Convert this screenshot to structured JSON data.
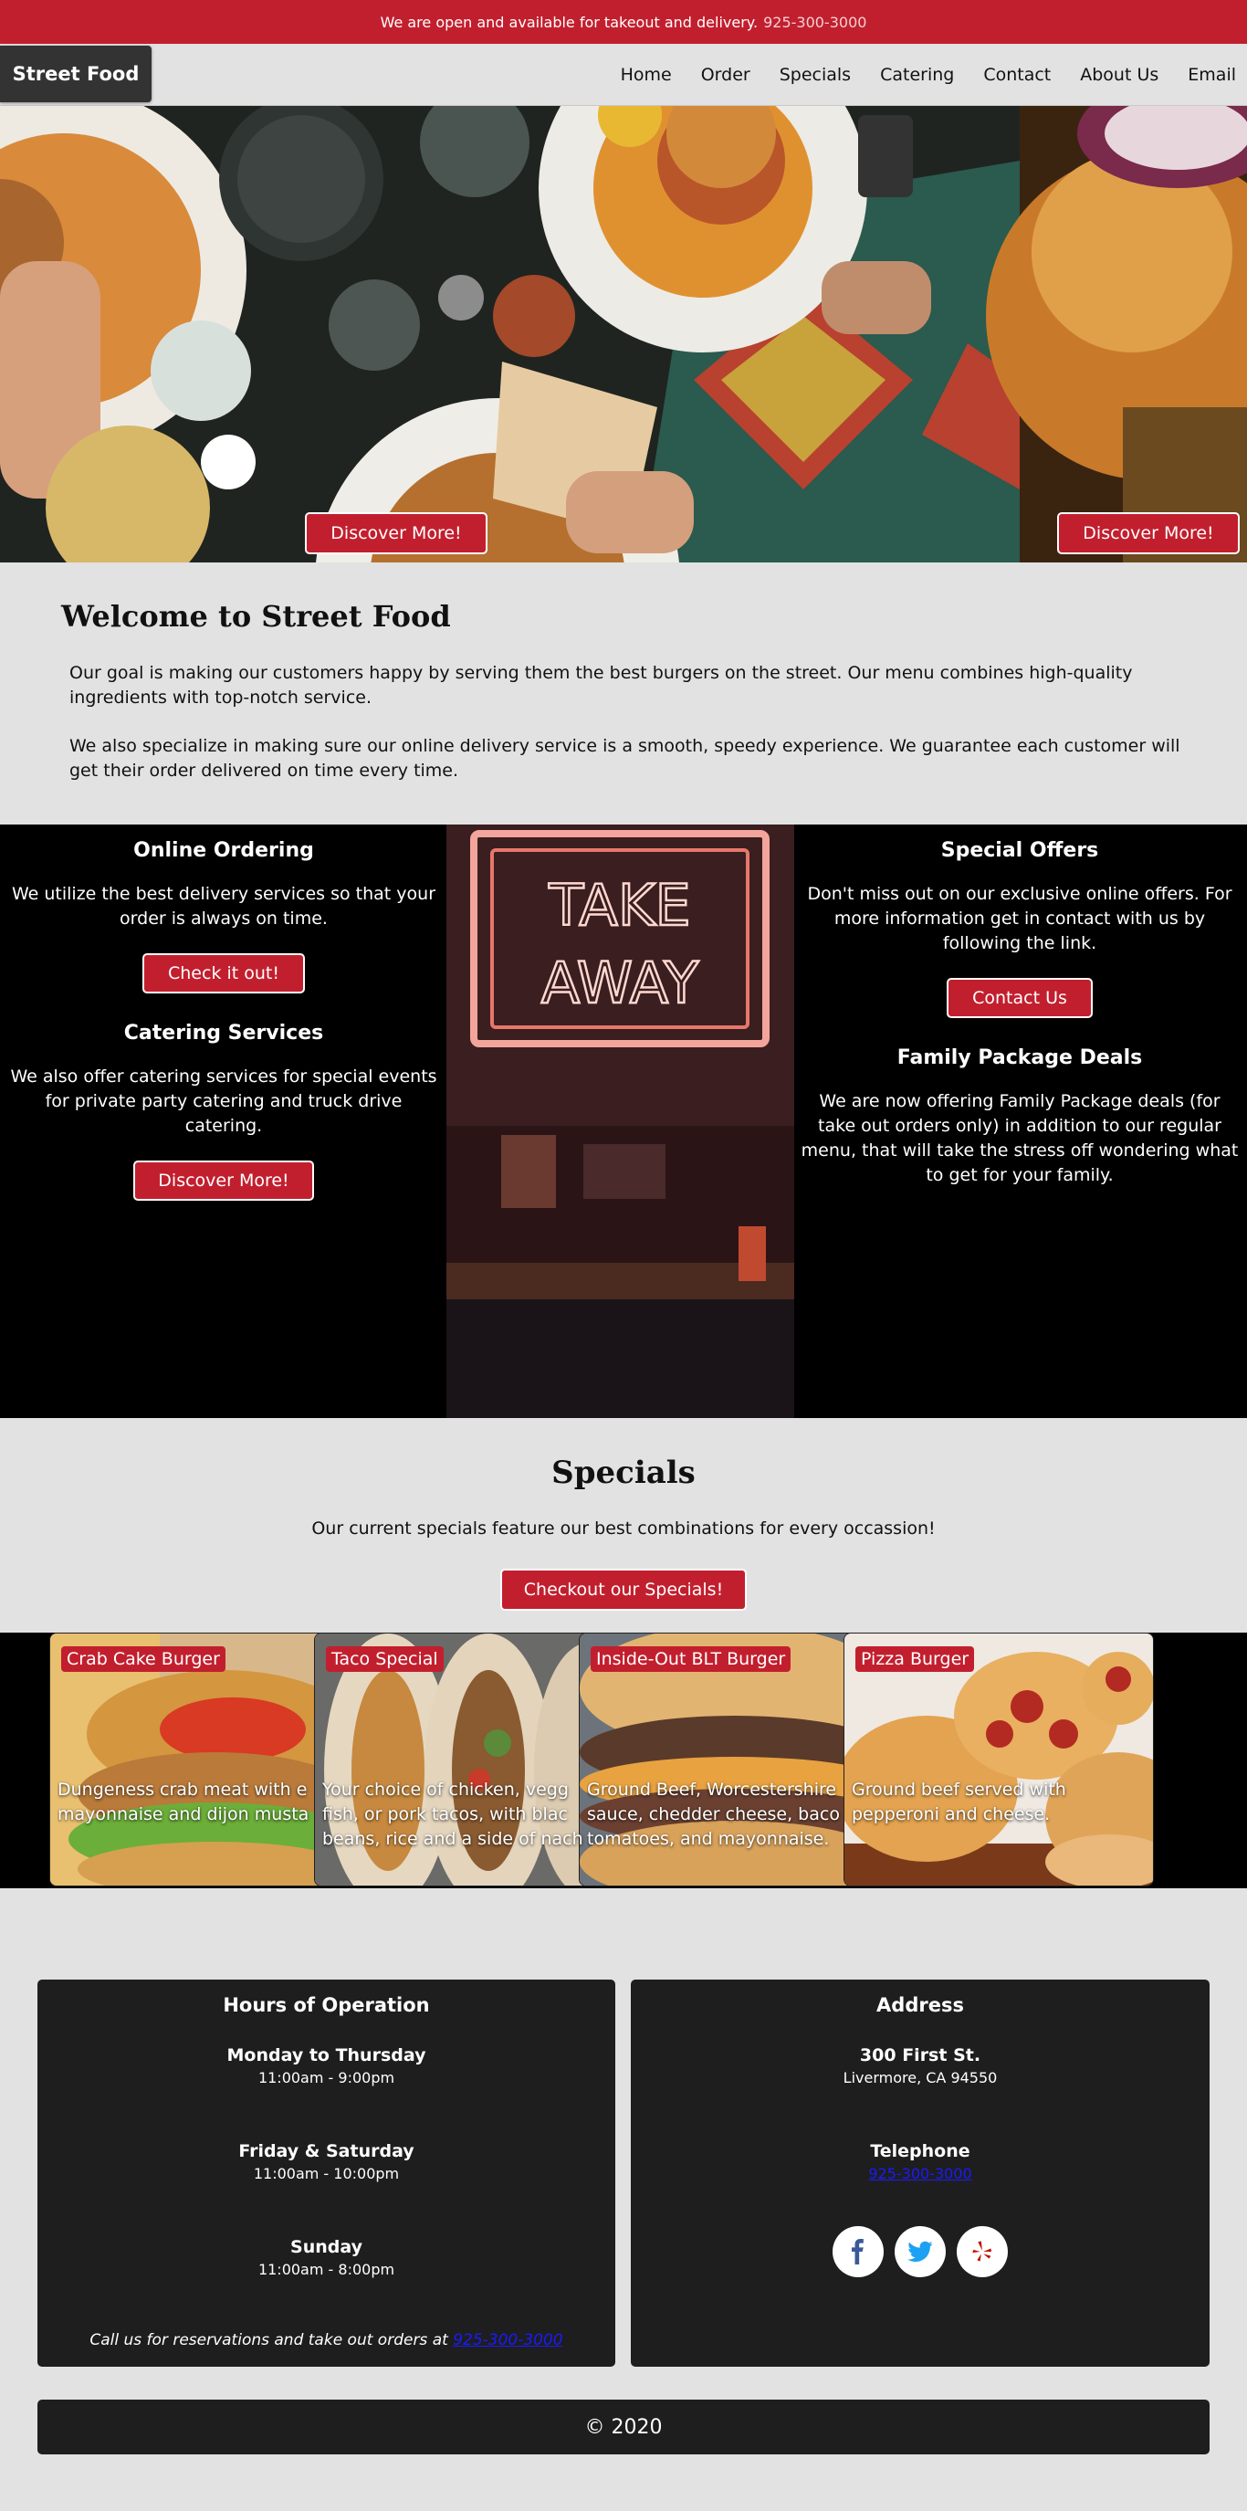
{
  "topbar": {
    "message": "We are open and available for takeout and delivery.",
    "phone": "925-300-3000"
  },
  "nav": {
    "brand": "Street Food",
    "links": [
      "Home",
      "Order",
      "Specials",
      "Catering",
      "Contact",
      "About Us",
      "Email"
    ]
  },
  "hero": {
    "button_left": "Discover More!",
    "button_right": "Discover More!"
  },
  "welcome": {
    "title": "Welcome to Street Food",
    "p1": "Our goal is making our customers happy by serving them the best burgers on the street. Our menu combines high-quality ingredients with top-notch service.",
    "p2": "We also specialize in making sure our online delivery service is a smooth, speedy experience. We guarantee each customer will get their order delivered on time every time."
  },
  "services": {
    "online": {
      "title": "Online Ordering",
      "text": "We utilize the best delivery services so that your order is always on time.",
      "button": "Check it out!"
    },
    "catering": {
      "title": "Catering Services",
      "text": "We also offer catering services for special events for private party catering and truck drive catering.",
      "button": "Discover More!"
    },
    "offers": {
      "title": "Special Offers",
      "text": "Don't miss out on our exclusive online offers. For more information get in contact with us by following the link.",
      "button": "Contact Us"
    },
    "family": {
      "title": "Family Package Deals",
      "text": "We are now offering Family Package deals (for take out orders only) in addition to our regular menu, that will take the stress off wondering what to get for your family."
    },
    "sign_text": [
      "TAKE",
      "AWAY"
    ]
  },
  "specials": {
    "title": "Specials",
    "text": "Our current specials feature our best combinations for every occassion!",
    "button": "Checkout our Specials!",
    "cards": [
      {
        "name": "Crab Cake Burger",
        "desc": "Dungeness crab meat with e\nmayonnaise and dijon musta"
      },
      {
        "name": "Taco Special",
        "desc": "Your choice of chicken, vegg\nfish, or pork tacos, with blac\nbeans, rice and a side of nach"
      },
      {
        "name": "Inside-Out BLT Burger",
        "desc": "Ground Beef, Worcestershire\nsauce, chedder cheese, baco\ntomatoes, and mayonnaise."
      },
      {
        "name": "Pizza Burger",
        "desc": "Ground beef served with\npepperoni and cheese."
      }
    ]
  },
  "hours": {
    "title": "Hours of Operation",
    "rows": [
      {
        "label": "Monday to Thursday",
        "value": "11:00am - 9:00pm"
      },
      {
        "label": "Friday & Saturday",
        "value": "11:00am - 10:00pm"
      },
      {
        "label": "Sunday",
        "value": "11:00am - 8:00pm"
      }
    ],
    "note": "Call us for reservations and take out orders at",
    "note_phone": "925-300-3000"
  },
  "address": {
    "title": "Address",
    "street": "300 First St.",
    "city": "Livermore, CA 94550",
    "phone_label": "Telephone",
    "phone": "925-300-3000",
    "social": [
      "facebook-icon",
      "twitter-icon",
      "yelp-icon"
    ]
  },
  "footer": {
    "text": "© 2020"
  },
  "colors": {
    "accent": "#c21f2e",
    "panel": "#1e1e1e",
    "page": "#e2e2e2"
  }
}
